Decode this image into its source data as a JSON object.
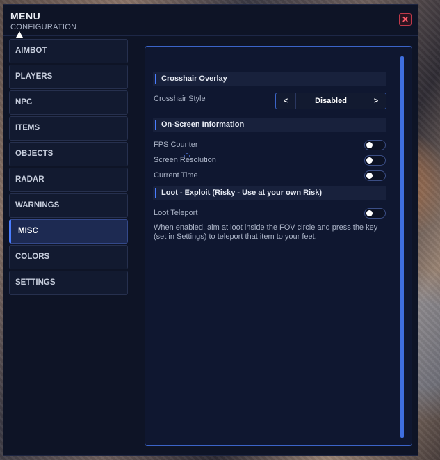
{
  "header": {
    "title": "MENU",
    "subtitle": "CONFIGURATION",
    "close_label": "✕"
  },
  "sidebar": {
    "items": [
      {
        "label": "AIMBOT"
      },
      {
        "label": "PLAYERS"
      },
      {
        "label": "NPC"
      },
      {
        "label": "ITEMS"
      },
      {
        "label": "OBJECTS"
      },
      {
        "label": "RADAR"
      },
      {
        "label": "WARNINGS"
      },
      {
        "label": "MISC",
        "active": true
      },
      {
        "label": "COLORS"
      },
      {
        "label": "SETTINGS"
      }
    ]
  },
  "panel": {
    "sections": {
      "crosshair": {
        "title": "Crosshair Overlay",
        "style_label": "Crosshair Style",
        "style_value": "Disabled",
        "prev_label": "<",
        "next_label": ">"
      },
      "onscreen": {
        "title": "On-Screen Information",
        "fps_label": "FPS Counter",
        "fps_enabled": false,
        "resolution_label": "Screen Resolution",
        "resolution_enabled": false,
        "time_label": "Current Time",
        "time_enabled": false
      },
      "loot": {
        "title": "Loot - Exploit (Risky - Use at your own Risk)",
        "teleport_label": "Loot Teleport",
        "teleport_enabled": false,
        "description": "When enabled, aim at loot inside the FOV circle and press the key (set in Settings) to teleport that item to your feet."
      }
    }
  },
  "colors": {
    "accent": "#4a7dff",
    "window_bg": "#0e1426",
    "close": "#ff5a6a"
  }
}
